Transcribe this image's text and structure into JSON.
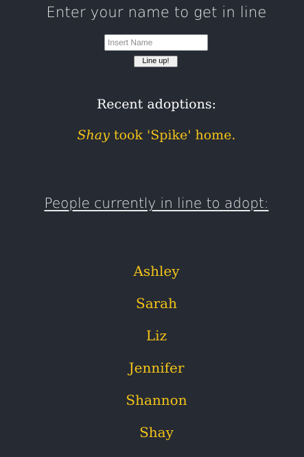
{
  "form": {
    "prompt": "Enter your name to get in line",
    "name_placeholder": "Insert Name",
    "name_value": "",
    "submit_label": "Line up!"
  },
  "recent": {
    "title": "Recent adoptions:",
    "items": [
      {
        "adopter": "Shay",
        "text": " took 'Spike' home."
      }
    ]
  },
  "queue": {
    "title": "People currently in line to adopt:",
    "names": [
      "Ashley",
      "Sarah",
      "Liz",
      "Jennifer",
      "Shannon",
      "Shay"
    ]
  },
  "colors": {
    "background": "#262a33",
    "accent": "#f5c518",
    "text": "#ffffff"
  }
}
